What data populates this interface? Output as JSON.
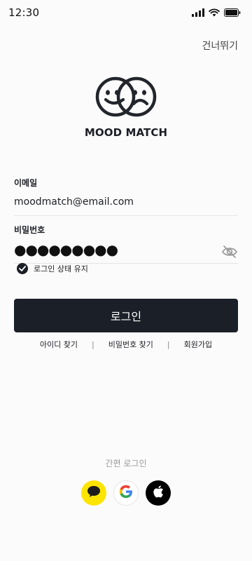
{
  "status_bar": {
    "time": "12:30"
  },
  "header": {
    "skip_label": "건너뛰기"
  },
  "brand": {
    "name": "MOOD MATCH"
  },
  "form": {
    "email_label": "이메일",
    "email_value": "moodmatch@email.com",
    "password_label": "비밀번호",
    "password_value": "●●●●●●●●●",
    "remember_label": "로그인 상태 유지",
    "remember_checked": true,
    "login_button_label": "로그인"
  },
  "links": {
    "find_id": "아이디 찾기",
    "find_password": "비밀번호 찾기",
    "sign_up": "회원가입",
    "separator": "|"
  },
  "social": {
    "label": "간편 로그인",
    "providers": [
      "kakao-icon",
      "google-icon",
      "apple-icon"
    ]
  },
  "colors": {
    "primary": "#1b1f27",
    "kakao": "#fee500",
    "background": "#fbfbfb"
  }
}
